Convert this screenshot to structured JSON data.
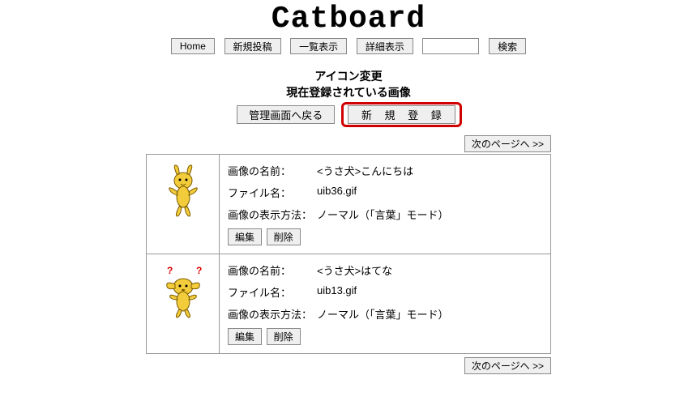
{
  "title": "Catboard",
  "nav": {
    "home": "Home",
    "new_post": "新規投稿",
    "list_view": "一覧表示",
    "detail_view": "詳細表示",
    "search": "検索",
    "search_value": ""
  },
  "subheader": {
    "line1": "アイコン変更",
    "line2": "現在登録されている画像"
  },
  "admin": {
    "back": "管理画面へ戻る",
    "new_register": "新 規 登 録"
  },
  "pager": {
    "next": "次のページへ >>"
  },
  "labels": {
    "image_name": "画像の名前：",
    "file_name": "ファイル名：",
    "display_method": "画像の表示方法：",
    "edit": "編集",
    "delete": "削除"
  },
  "rows": [
    {
      "image_name": "<うさ犬>こんにちは",
      "file_name": "uib36.gif",
      "display_method": "ノーマル（「言葉」モード）"
    },
    {
      "image_name": "<うさ犬>はてな",
      "file_name": "uib13.gif",
      "display_method": "ノーマル（「言葉」モード）"
    }
  ]
}
